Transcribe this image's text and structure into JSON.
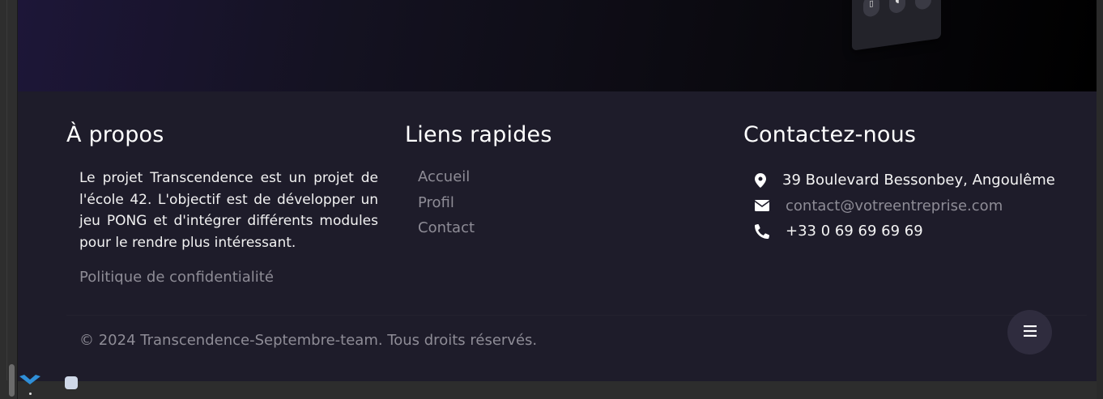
{
  "about": {
    "title": "À propos",
    "text": "Le projet Transcendence est un projet de l'école 42. L'objectif est de développer un jeu PONG et d'intégrer différents modules pour le rendre plus intéressant.",
    "privacy_link": "Politique de confidentialité"
  },
  "quick_links": {
    "title": "Liens rapides",
    "items": [
      "Accueil",
      "Profil",
      "Contact"
    ]
  },
  "contact": {
    "title": "Contactez-nous",
    "address": "39 Boulevard Bessonbey, Angoulême",
    "email": "contact@votreentreprise.com",
    "phone": "+33 0 69 69 69 69"
  },
  "footer": {
    "copyright": "© 2024 Transcendence-Septembre-team. Tous droits réservés."
  },
  "icons": {
    "address": "map-pin-icon",
    "email": "envelope-icon",
    "phone": "phone-icon",
    "menu": "hamburger-menu-icon"
  },
  "colors": {
    "footer_bg": "#1e1c2a",
    "link_grey": "#8e8c96",
    "menu_button_bg": "#2f2c3e"
  }
}
